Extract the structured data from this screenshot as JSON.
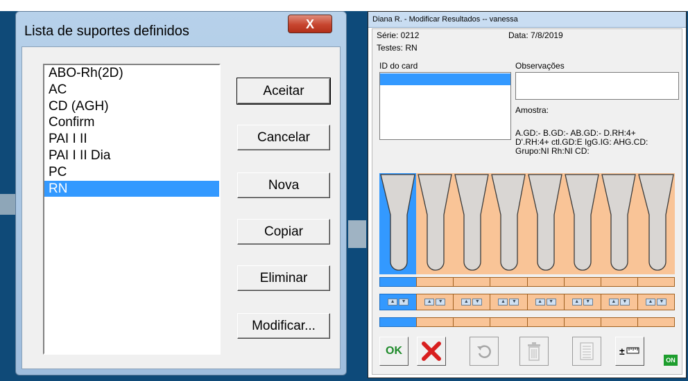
{
  "dialog_supports": {
    "title": "Lista de suportes definidos",
    "close_label": "X",
    "items": [
      "ABO-Rh(2D)",
      "AC",
      "CD (AGH)",
      "Confirm",
      "PAI I II",
      "PAI I II Dia",
      "PC",
      "RN"
    ],
    "selected_index": 7,
    "buttons": {
      "accept": "Aceitar",
      "cancel": "Cancelar",
      "new": "Nova",
      "copy": "Copiar",
      "delete": "Eliminar",
      "modify": "Modificar..."
    }
  },
  "dialog_results": {
    "title": "Diana R. - Modificar Resultados -- vanessa",
    "serie": "Série: 0212",
    "data": "Data: 7/8/2019",
    "testes": "Testes: RN",
    "id_card_label": "ID do card",
    "observacoes_label": "Observações",
    "amostra_label": "Amostra:",
    "results_line1": "A.GD:-  B.GD:-  AB.GD:-  D.RH:4+",
    "results_line2": "D'.RH:4+  ctl.GD:E  IgG.IG:  AHG.CD:",
    "results_line3": "Grupo:NI  Rh:NI  CD:",
    "card_columns": 8,
    "selected_column": 1,
    "toolbar": {
      "ok_label": "OK",
      "cancel_icon": "red-x-icon",
      "undo_icon": "undo-icon",
      "trash_icon": "trash-icon",
      "report_icon": "report-icon",
      "adjust_icon": "plus-minus-ruler-icon",
      "on_badge": "ON"
    },
    "colors": {
      "well_fill": "#f9c497",
      "selected_blue": "#3399ff",
      "tube_gray": "#d9d6d3"
    }
  }
}
